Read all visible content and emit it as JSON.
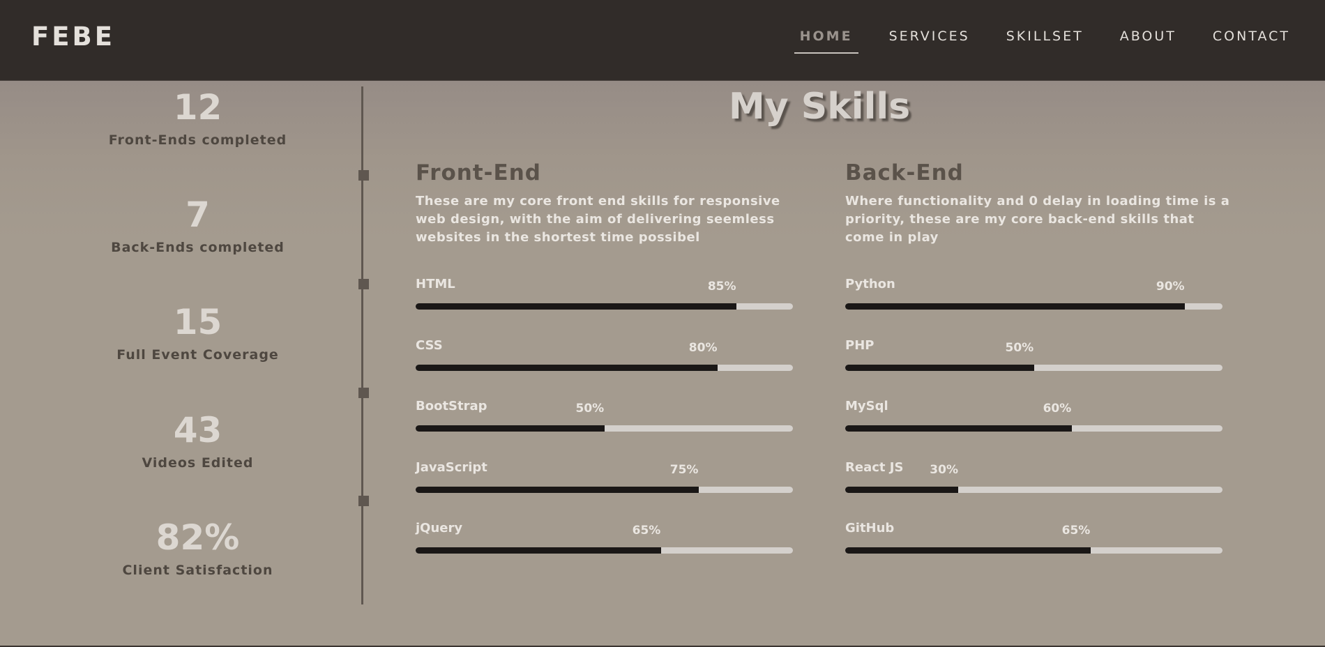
{
  "brand": "FEBE",
  "nav": [
    "HOME",
    "SERVICES",
    "SKILLSET",
    "ABOUT",
    "CONTACT"
  ],
  "nav_active": "HOME",
  "stats": [
    {
      "value": "12",
      "label": "Front-Ends completed"
    },
    {
      "value": "7",
      "label": "Back-Ends completed"
    },
    {
      "value": "15",
      "label": "Full Event Coverage"
    },
    {
      "value": "43",
      "label": "Videos Edited"
    },
    {
      "value": "82%",
      "label": "Client Satisfaction"
    }
  ],
  "skills": {
    "title": "My Skills",
    "frontend": {
      "title": "Front-End",
      "description": "These are my core front end skills for responsive web design, with the aim of delivering seemless websites in the shortest time possibel",
      "items": [
        {
          "name": "HTML",
          "percent_label": "85%",
          "percent": 85
        },
        {
          "name": "CSS",
          "percent_label": "80%",
          "percent": 80
        },
        {
          "name": "BootStrap",
          "percent_label": "50%",
          "percent": 50
        },
        {
          "name": "JavaScript",
          "percent_label": "75%",
          "percent": 75
        },
        {
          "name": "jQuery",
          "percent_label": "65%",
          "percent": 65
        }
      ]
    },
    "backend": {
      "title": "Back-End",
      "description": "Where functionality and 0 delay in loading time is a priority, these are my core back-end skills that come in play",
      "items": [
        {
          "name": "Python",
          "percent_label": "90%",
          "percent": 90
        },
        {
          "name": "PHP",
          "percent_label": "50%",
          "percent": 50
        },
        {
          "name": "MySql",
          "percent_label": "60%",
          "percent": 60
        },
        {
          "name": "React JS",
          "percent_label": "30%",
          "percent": 30
        },
        {
          "name": "GitHub",
          "percent_label": "65%",
          "percent": 65
        }
      ]
    }
  },
  "colors": {
    "navbar": "#312c29",
    "background": "#a49b8f",
    "bar_fill": "#1a1716",
    "bar_track": "#d4d0cc"
  }
}
